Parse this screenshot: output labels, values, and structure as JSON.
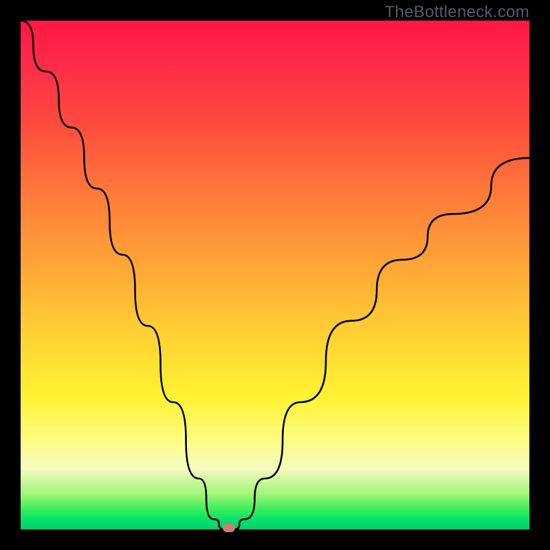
{
  "watermark": "TheBottleneck.com",
  "chart_data": {
    "type": "line",
    "title": "",
    "xlabel": "",
    "ylabel": "",
    "xlim": [
      0,
      100
    ],
    "ylim": [
      0,
      100
    ],
    "grid": false,
    "series": [
      {
        "name": "bottleneck-curve",
        "x": [
          0,
          5,
          10,
          15,
          20,
          25,
          30,
          35,
          38,
          40,
          42,
          44,
          48,
          55,
          65,
          75,
          85,
          100
        ],
        "values": [
          100,
          90,
          79,
          67,
          54,
          40,
          25,
          10,
          2,
          0,
          0,
          2,
          10,
          25,
          41,
          53,
          62,
          73
        ]
      }
    ],
    "marker": {
      "x": 41,
      "y": 0
    },
    "background_gradient": {
      "direction": "vertical",
      "stops": [
        {
          "pos": 0,
          "color": "#ff1744"
        },
        {
          "pos": 34,
          "color": "#ff7a3a"
        },
        {
          "pos": 62,
          "color": "#ffd233"
        },
        {
          "pos": 88,
          "color": "#f7fbc0"
        },
        {
          "pos": 100,
          "color": "#00d070"
        }
      ]
    }
  }
}
